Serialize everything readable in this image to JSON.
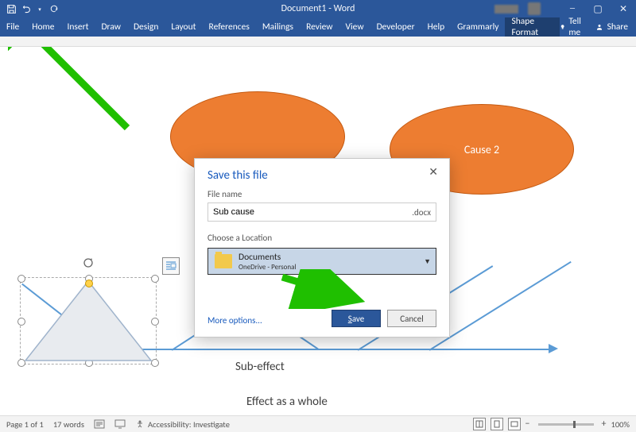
{
  "titlebar": {
    "title": "Document1 - Word"
  },
  "ribbon": {
    "tabs": [
      "File",
      "Home",
      "Insert",
      "Draw",
      "Design",
      "Layout",
      "References",
      "Mailings",
      "Review",
      "View",
      "Developer",
      "Help",
      "Grammarly",
      "Shape Format"
    ],
    "active_tab": "Shape Format",
    "tell_me": "Tell me",
    "share": "Share"
  },
  "shapes": {
    "cause2_label": "Cause 2",
    "sub_effect": "Sub-effect",
    "effect_whole": "Effect as a whole"
  },
  "dialog": {
    "title": "Save this file",
    "file_name_label": "File name",
    "file_name_value": "Sub cause",
    "extension": ".docx",
    "location_label": "Choose a Location",
    "location_name": "Documents",
    "location_sub": "OneDrive - Personal",
    "more_options": "More options...",
    "save": "Save",
    "cancel": "Cancel"
  },
  "statusbar": {
    "page": "Page 1 of 1",
    "words": "17 words",
    "accessibility": "Accessibility: Investigate",
    "zoom": "100%"
  }
}
